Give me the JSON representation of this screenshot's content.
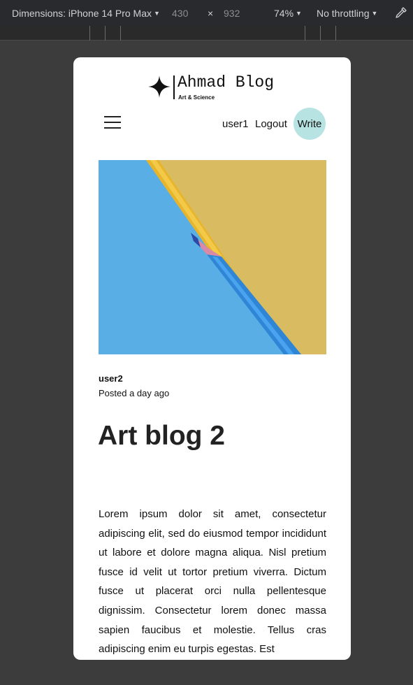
{
  "devtools": {
    "dimensions_label": "Dimensions: iPhone 14 Pro Max",
    "width": "430",
    "times": "×",
    "height": "932",
    "zoom": "74%",
    "throttling": "No throttling"
  },
  "header": {
    "logo_title": "Ahmad Blog",
    "logo_subtitle": "Art & Science",
    "username": "user1",
    "logout_label": "Logout",
    "write_label": "Write"
  },
  "post": {
    "author": "user2",
    "posted": "Posted a day ago",
    "title": "Art blog 2",
    "body": "Lorem ipsum dolor sit amet, consectetur adipiscing elit, sed do eiusmod tempor incididunt ut labore et dolore magna aliqua. Nisl pretium fusce id velit ut tortor pretium viverra. Dictum fusce ut placerat orci nulla pellentesque dignissim. Consectetur lorem donec massa sapien faucibus et molestie. Tellus cras adipiscing enim eu turpis egestas. Est"
  },
  "icons": {
    "menu": "hamburger-menu-icon",
    "logo": "four-point-star-icon",
    "picker": "eyedropper-icon",
    "caret": "caret-down-icon"
  },
  "colors": {
    "page_bg": "#3c3c3c",
    "toolbar_bg": "#292a2d",
    "write_button": "#b7e4e3",
    "hero_blue": "#5aaee6",
    "hero_yellow": "#d9bb62"
  }
}
